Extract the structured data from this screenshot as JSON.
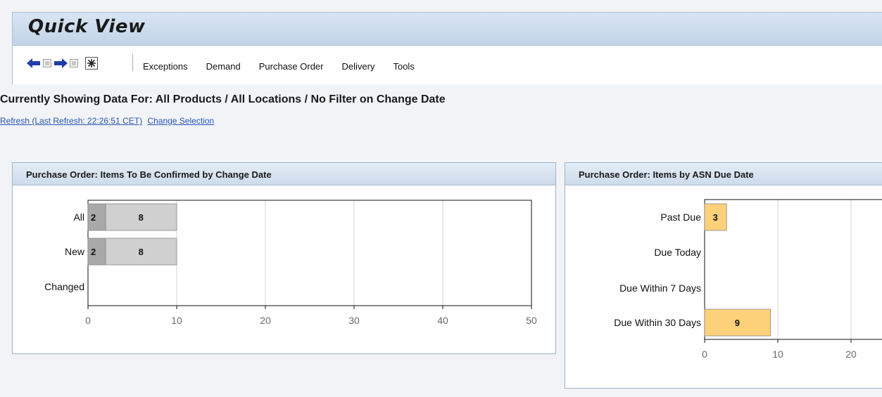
{
  "header": {
    "title": "Quick View"
  },
  "toolbar": {
    "icons": [
      "back-arrow-icon",
      "page-icon",
      "forward-arrow-icon",
      "page-icon",
      "asterisk-icon"
    ],
    "menu": [
      "Exceptions",
      "Demand",
      "Purchase Order",
      "Delivery",
      "Tools"
    ]
  },
  "context": {
    "showing": "Currently Showing Data For: All Products / All Locations / No Filter on Change Date",
    "refresh_link": "Refresh (Last Refresh: 22:26:51 CET)",
    "change_link": "Change Selection"
  },
  "colors": {
    "header_bg": "#c2d4e8",
    "bar_dark": "#a9a9a9",
    "bar_light": "#d0d0d0",
    "bar_yellow": "#fdd17a",
    "link": "#2a57b8"
  },
  "panels": [
    {
      "title": "Purchase Order: Items To Be Confirmed by Change Date"
    },
    {
      "title": "Purchase Order: Items by ASN Due Date"
    }
  ],
  "chart_data": [
    {
      "type": "bar",
      "orientation": "horizontal",
      "stacked": true,
      "title": "Purchase Order: Items To Be Confirmed by Change Date",
      "categories": [
        "All",
        "New",
        "Changed"
      ],
      "series": [
        {
          "values": [
            2,
            2,
            0
          ],
          "color": "#a9a9a9"
        },
        {
          "values": [
            8,
            8,
            0
          ],
          "color": "#d0d0d0"
        }
      ],
      "xlim": [
        0,
        50
      ],
      "xticks": [
        0,
        10,
        20,
        30,
        40,
        50
      ],
      "grid": true
    },
    {
      "type": "bar",
      "orientation": "horizontal",
      "title": "Purchase Order: Items by ASN Due Date",
      "categories": [
        "Past Due",
        "Due Today",
        "Due Within 7 Days",
        "Due Within 30 Days"
      ],
      "series": [
        {
          "values": [
            3,
            0,
            0,
            9
          ],
          "color": "#fdd17a"
        }
      ],
      "xticks": [
        0,
        10,
        20
      ],
      "grid": true
    }
  ]
}
